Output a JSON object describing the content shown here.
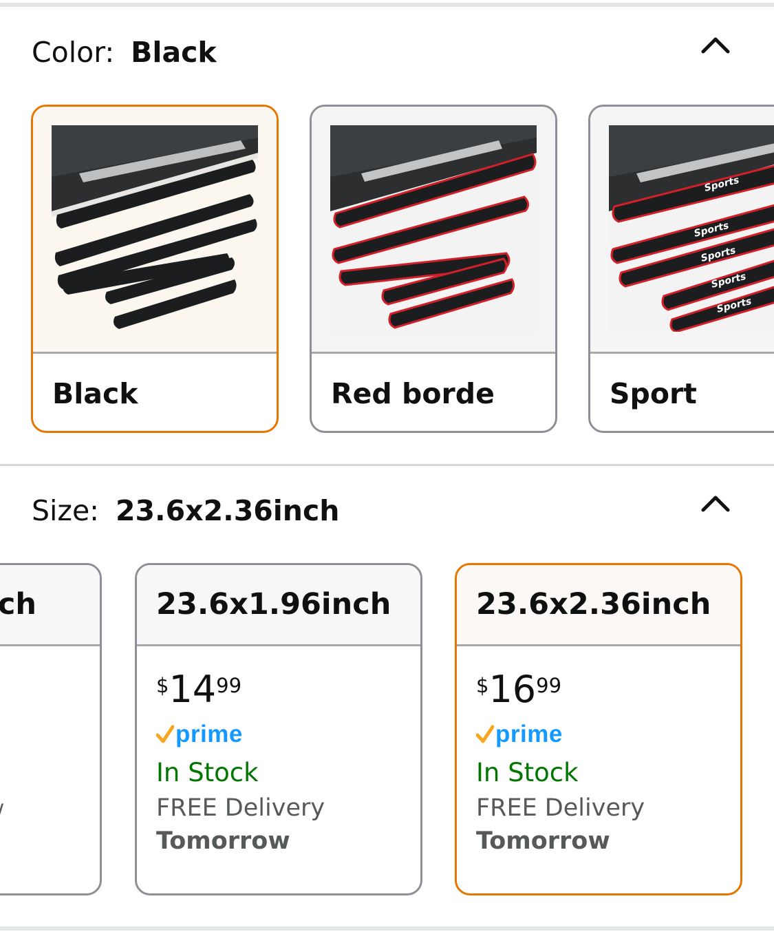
{
  "color_section": {
    "label": "Color:",
    "selected": "Black",
    "options": [
      {
        "name": "Black",
        "selected": true
      },
      {
        "name": "Red borde",
        "selected": false
      },
      {
        "name": "Sport",
        "selected": false
      }
    ]
  },
  "size_section": {
    "label": "Size:",
    "selected": "23.6x2.36inch",
    "options": [
      {
        "label": "nch",
        "selected": false,
        "side_mark": "/"
      },
      {
        "label": "23.6x1.96inch",
        "price_currency": "$",
        "price_whole": "14",
        "price_fraction": "99",
        "prime": "prime",
        "stock": "In Stock",
        "delivery": "FREE Delivery",
        "delivery_day": "Tomorrow",
        "selected": false
      },
      {
        "label": "23.6x2.36inch",
        "price_currency": "$",
        "price_whole": "16",
        "price_fraction": "99",
        "prime": "prime",
        "stock": "In Stock",
        "delivery": "FREE Delivery",
        "delivery_day": "Tomorrow",
        "selected": true
      }
    ]
  },
  "sport_sticker_text": "Sports",
  "colors": {
    "selected_border": "#e77600",
    "default_border": "#8d9096",
    "in_stock": "#007600",
    "prime_blue": "#1399ff",
    "prime_check": "#f7a61d",
    "red_trim": "#d0202a"
  },
  "icons": [
    "chevron-up-icon",
    "prime-check-icon"
  ]
}
